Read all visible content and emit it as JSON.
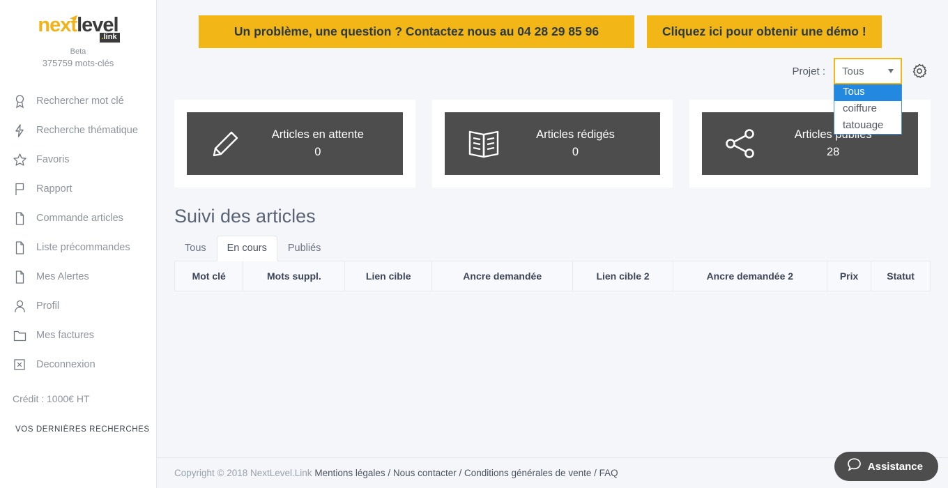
{
  "sidebar": {
    "logo": {
      "part1": "next",
      "part2": "level",
      "badge_dot": ".",
      "badge_text": "link"
    },
    "beta": "Beta",
    "keyword_count": "375759 mots-clés",
    "items": [
      {
        "label": "Rechercher mot clé",
        "icon": "award-icon"
      },
      {
        "label": "Recherche thématique",
        "icon": "bolt-icon"
      },
      {
        "label": "Favoris",
        "icon": "star-icon"
      },
      {
        "label": "Rapport",
        "icon": "flag-icon"
      },
      {
        "label": "Commande articles",
        "icon": "document-icon"
      },
      {
        "label": "Liste précommandes",
        "icon": "document-icon"
      },
      {
        "label": "Mes Alertes",
        "icon": "document-icon"
      },
      {
        "label": "Profil",
        "icon": "user-icon"
      },
      {
        "label": "Mes factures",
        "icon": "folder-icon"
      },
      {
        "label": "Deconnexion",
        "icon": "logout-icon"
      }
    ],
    "credit": "Crédit : 1000€ HT",
    "last_searches_title": "VOS DERNIÈRES RECHERCHES"
  },
  "banners": {
    "contact": "Un problème, une question ? Contactez nous au 04 28 29 85 96",
    "demo": "Cliquez ici pour obtenir une démo !"
  },
  "project_selector": {
    "label": "Projet :",
    "value": "Tous",
    "options": [
      "Tous",
      "coiffure",
      "tatouage"
    ],
    "selected_index": 0
  },
  "stat_cards": [
    {
      "title": "Articles en attente",
      "value": "0",
      "icon": "pencil-icon"
    },
    {
      "title": "Articles rédigés",
      "value": "0",
      "icon": "book-icon"
    },
    {
      "title": "Articles publiés",
      "value": "28",
      "icon": "share-icon"
    }
  ],
  "articles_section": {
    "title": "Suivi des articles",
    "tabs": [
      {
        "label": "Tous",
        "active": false
      },
      {
        "label": "En cours",
        "active": true
      },
      {
        "label": "Publiés",
        "active": false
      }
    ],
    "columns": [
      "Mot clé",
      "Mots suppl.",
      "Lien cible",
      "Ancre demandée",
      "Lien cible 2",
      "Ancre demandée 2",
      "Prix",
      "Statut"
    ],
    "rows": []
  },
  "footer": {
    "copyright": "Copyright © 2018 NextLevel.Link",
    "links": [
      "Mentions légales",
      "Nous contacter",
      "Conditions générales de vente",
      "FAQ"
    ],
    "separator": " / "
  },
  "assistance": {
    "label": "Assistance",
    "icon": "chat-bubble-icon"
  },
  "colors": {
    "accent_yellow": "#f2b617",
    "banner_text": "#2b3a4a",
    "card_dark": "#4d4d4d",
    "dropdown_highlight": "#2389e0",
    "page_bg": "#f4f6fa"
  }
}
